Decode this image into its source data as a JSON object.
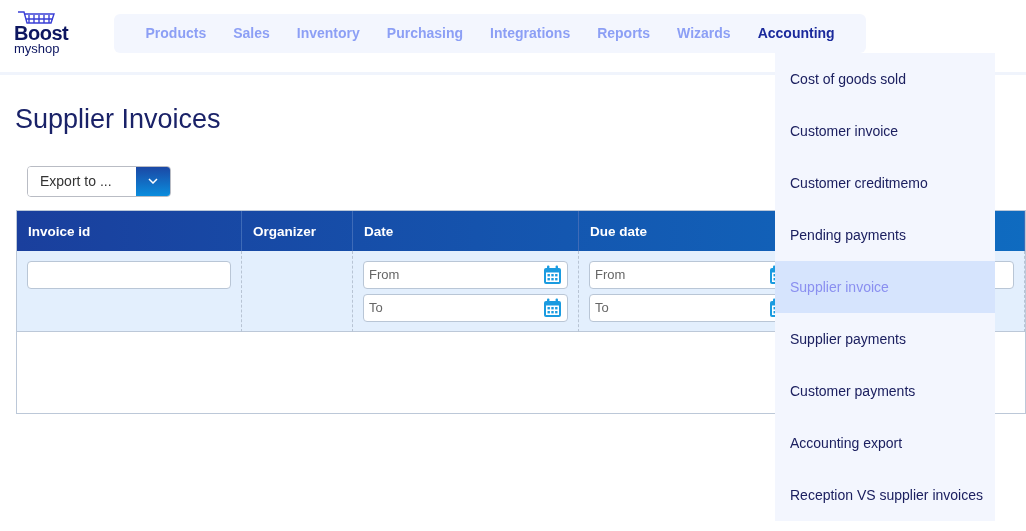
{
  "logo": {
    "line_1": "Boost",
    "line_2": "myshop"
  },
  "nav": [
    {
      "label": "Products",
      "selected": false
    },
    {
      "label": "Sales",
      "selected": false
    },
    {
      "label": "Inventory",
      "selected": false
    },
    {
      "label": "Purchasing",
      "selected": false
    },
    {
      "label": "Integrations",
      "selected": false
    },
    {
      "label": "Reports",
      "selected": false
    },
    {
      "label": "Wizards",
      "selected": false
    },
    {
      "label": "Accounting",
      "selected": true
    }
  ],
  "page_title": "Supplier Invoices",
  "export": {
    "label": "Export to ..."
  },
  "table": {
    "columns": [
      {
        "label": "Invoice id",
        "kind": "text"
      },
      {
        "label": "Organizer",
        "kind": "none"
      },
      {
        "label": "Date",
        "kind": "date_range",
        "from_placeholder": "From",
        "to_placeholder": "To"
      },
      {
        "label": "Due date",
        "kind": "date_range",
        "from_placeholder": "From",
        "to_placeholder": "To"
      },
      {
        "kind": "text"
      }
    ]
  },
  "menu": [
    {
      "label": "Cost of goods sold",
      "selected": false
    },
    {
      "label": "Customer invoice",
      "selected": false
    },
    {
      "label": "Customer creditmemo",
      "selected": false
    },
    {
      "label": "Pending payments",
      "selected": false
    },
    {
      "label": "Supplier invoice",
      "selected": true
    },
    {
      "label": "Supplier payments",
      "selected": false
    },
    {
      "label": "Customer payments",
      "selected": false
    },
    {
      "label": "Accounting export",
      "selected": false
    },
    {
      "label": "Reception VS supplier invoices",
      "selected": false
    }
  ]
}
